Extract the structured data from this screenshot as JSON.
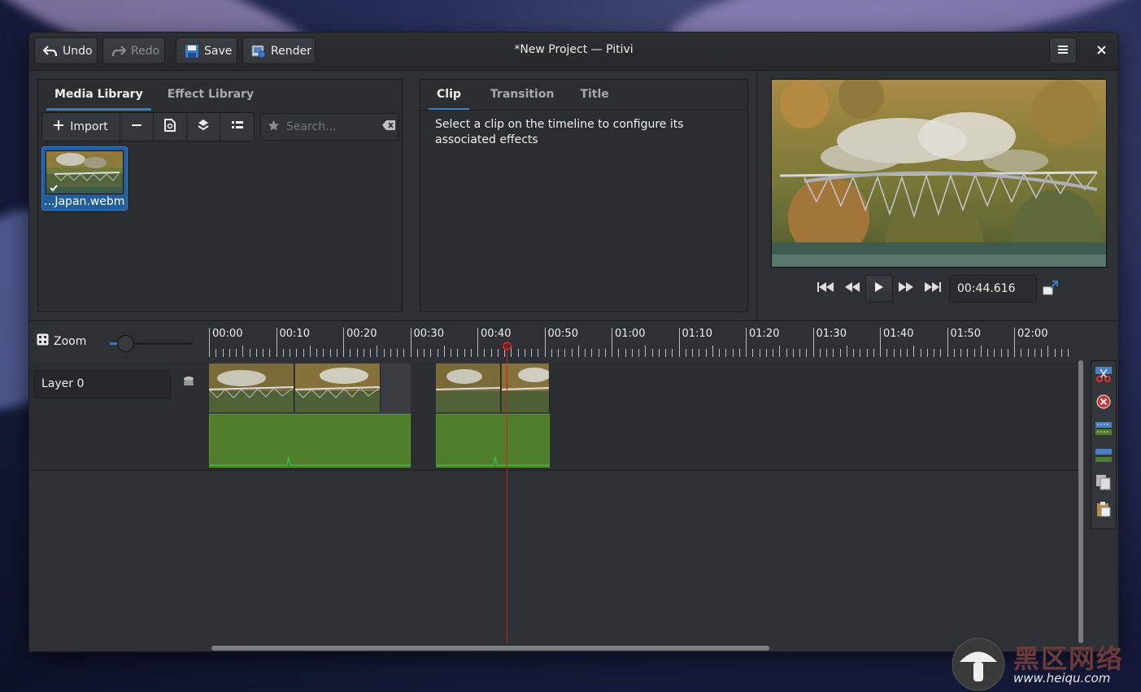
{
  "window": {
    "title": "*New Project — Pitivi"
  },
  "header": {
    "undo_label": "Undo",
    "redo_label": "Redo",
    "save_label": "Save",
    "render_label": "Render",
    "menu_icon": "hamburger-menu-icon",
    "close_icon": "close-icon"
  },
  "left_panel": {
    "tabs": [
      "Media Library",
      "Effect Library"
    ],
    "active_tab": "Media Library",
    "import_label": "Import",
    "search_placeholder": "Search...",
    "media_items": [
      {
        "label": "...Japan.webm"
      }
    ]
  },
  "middle_panel": {
    "tabs": [
      "Clip",
      "Transition",
      "Title"
    ],
    "active_tab": "Clip",
    "help_text": "Select a clip on the timeline to configure its associated effects"
  },
  "viewer": {
    "timecode": "00:44.616"
  },
  "timeline": {
    "zoom_label": "Zoom",
    "zoom_level": 0.1,
    "ruler_labels": [
      "00:00",
      "00:10",
      "00:20",
      "00:30",
      "00:40",
      "00:50",
      "01:00",
      "01:10",
      "01:20",
      "01:30",
      "01:40",
      "01:50",
      "02:00"
    ],
    "layers": [
      {
        "name": "Layer 0"
      }
    ]
  },
  "watermark": {
    "text": "黑区网络",
    "url": "www.heiqu.com"
  },
  "colors": {
    "accent": "#3a7cc4",
    "playhead": "#d02020",
    "audio": "#4f7d2a"
  }
}
